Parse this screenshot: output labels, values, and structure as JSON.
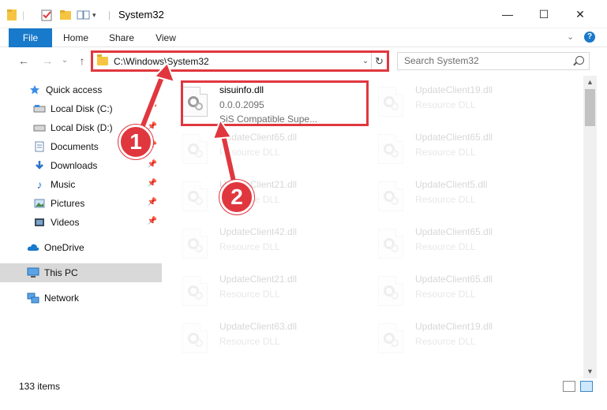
{
  "window": {
    "title": "System32",
    "minimize": "—",
    "maximize": "☐",
    "close": "✕"
  },
  "ribbon": {
    "tabs": [
      "File",
      "Home",
      "Share",
      "View"
    ]
  },
  "nav": {
    "back": "←",
    "forward": "→",
    "recent": "⌄",
    "up": "↑",
    "address": "C:\\Windows\\System32",
    "dropdown": "⌄",
    "refresh": "↻",
    "search_placeholder": "Search System32"
  },
  "sidebar": {
    "items": [
      {
        "label": "Quick access",
        "icon": "star-icon",
        "pinned": false
      },
      {
        "label": "Local Disk (C:)",
        "icon": "drive-icon",
        "pinned": true
      },
      {
        "label": "Local Disk (D:)",
        "icon": "drive-icon",
        "pinned": true
      },
      {
        "label": "Documents",
        "icon": "documents-icon",
        "pinned": true
      },
      {
        "label": "Downloads",
        "icon": "download-icon",
        "pinned": true
      },
      {
        "label": "Music",
        "icon": "music-icon",
        "pinned": true
      },
      {
        "label": "Pictures",
        "icon": "pictures-icon",
        "pinned": true
      },
      {
        "label": "Videos",
        "icon": "videos-icon",
        "pinned": true
      },
      {
        "label": "OneDrive",
        "icon": "cloud-icon",
        "pinned": false
      },
      {
        "label": "This PC",
        "icon": "computer-icon",
        "pinned": false,
        "selected": true
      },
      {
        "label": "Network",
        "icon": "network-icon",
        "pinned": false
      }
    ]
  },
  "files": [
    {
      "name": "sisuinfo.dll",
      "version": "0.0.0.2095",
      "desc": "SiS Compatible Supe...",
      "highlight": true
    },
    {
      "name": "UpdateClient19.dll",
      "desc": "Resource DLL"
    },
    {
      "name": "UpdateClient65.dll",
      "desc": "Resource DLL"
    },
    {
      "name": "UpdateClient65.dll",
      "desc": "Resource DLL"
    },
    {
      "name": "UpdateClient21.dll",
      "desc": "Resource DLL"
    },
    {
      "name": "UpdateClient5.dll",
      "desc": "Resource DLL"
    },
    {
      "name": "UpdateClient42.dll",
      "desc": "Resource DLL"
    },
    {
      "name": "UpdateClient65.dll",
      "desc": "Resource DLL"
    },
    {
      "name": "UpdateClient21.dll",
      "desc": "Resource DLL"
    },
    {
      "name": "UpdateClient65.dll",
      "desc": "Resource DLL"
    },
    {
      "name": "UpdateClient63.dll",
      "desc": "Resource DLL"
    },
    {
      "name": "UpdateClient19.dll",
      "desc": "Resource DLL"
    }
  ],
  "status": {
    "item_count": "133 items"
  },
  "callouts": [
    "1",
    "2"
  ],
  "colors": {
    "accent": "#1979ca",
    "highlight": "#e0373f"
  }
}
